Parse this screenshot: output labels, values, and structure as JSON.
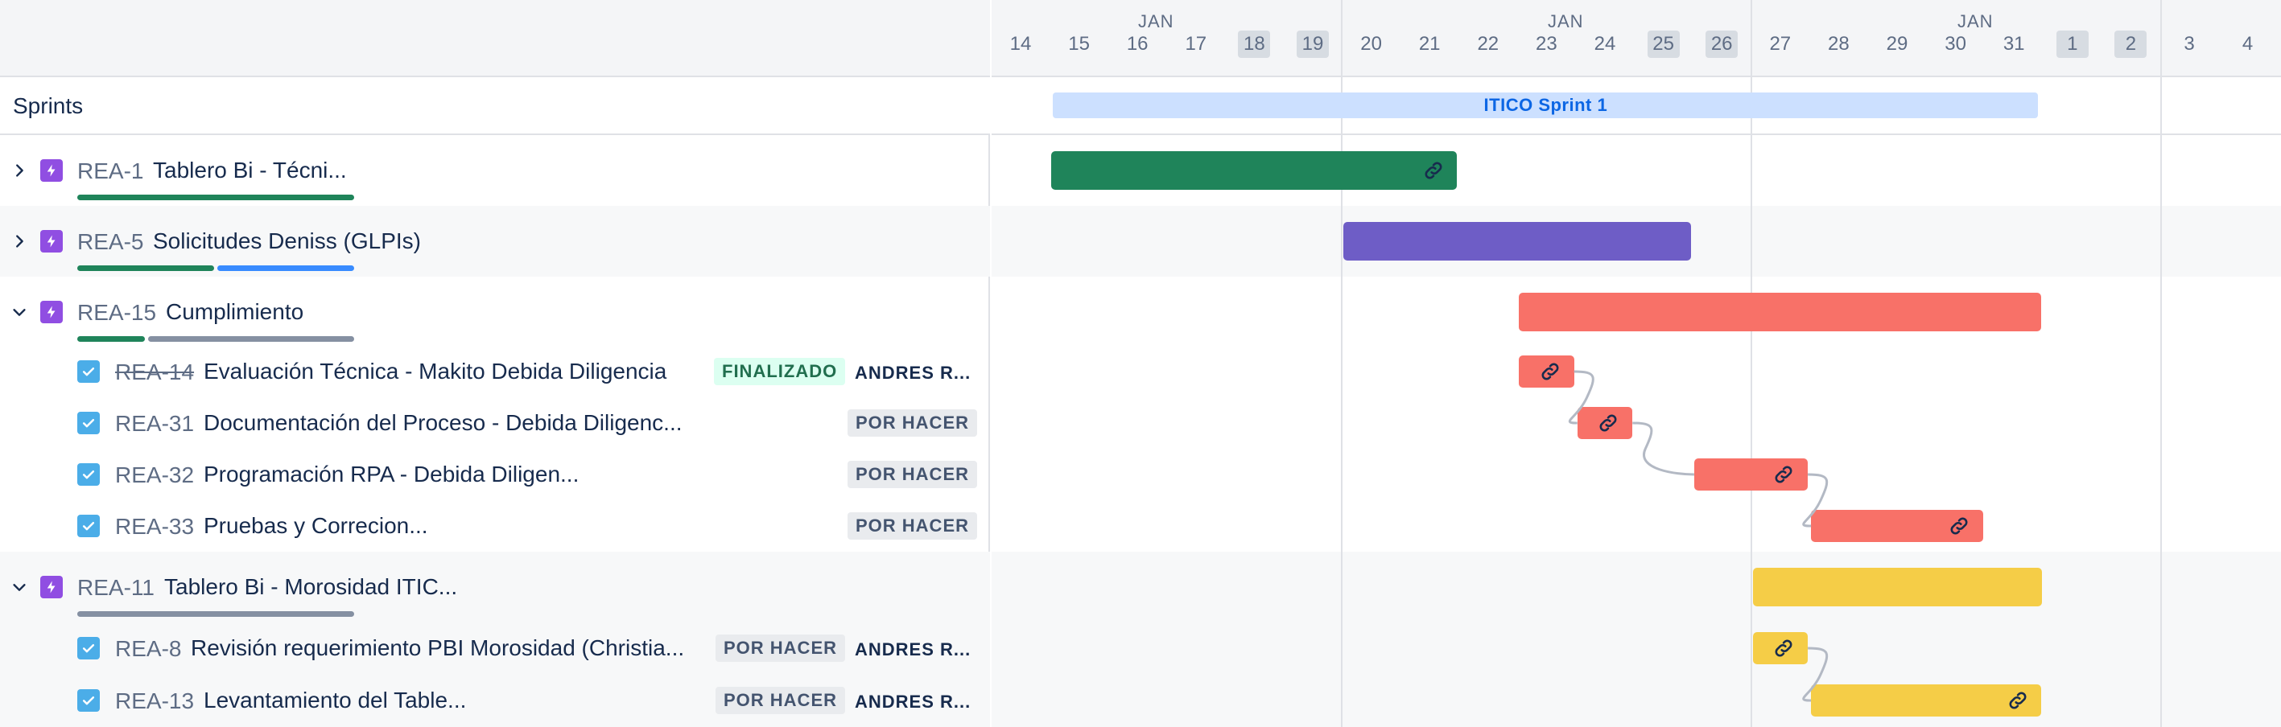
{
  "colors": {
    "green": "#1f845a",
    "purple": "#6e5dc6",
    "red": "#f87168",
    "yellow": "#f5cd47",
    "blue_progress": "#388bff",
    "grey_progress": "#8590a2",
    "sprint_bg": "#cce0ff",
    "sprint_text": "#0c66e4"
  },
  "left": {
    "sprints_label": "Sprints"
  },
  "timeline": {
    "month_labels": [
      "JAN",
      "JAN",
      "JAN"
    ],
    "days": [
      {
        "label": "14",
        "weekend": false
      },
      {
        "label": "15",
        "weekend": false
      },
      {
        "label": "16",
        "weekend": false
      },
      {
        "label": "17",
        "weekend": false
      },
      {
        "label": "18",
        "weekend": true
      },
      {
        "label": "19",
        "weekend": true
      },
      {
        "label": "20",
        "weekend": false
      },
      {
        "label": "21",
        "weekend": false
      },
      {
        "label": "22",
        "weekend": false
      },
      {
        "label": "23",
        "weekend": false
      },
      {
        "label": "24",
        "weekend": false
      },
      {
        "label": "25",
        "weekend": true
      },
      {
        "label": "26",
        "weekend": true
      },
      {
        "label": "27",
        "weekend": false
      },
      {
        "label": "28",
        "weekend": false
      },
      {
        "label": "29",
        "weekend": false
      },
      {
        "label": "30",
        "weekend": false
      },
      {
        "label": "31",
        "weekend": false
      },
      {
        "label": "1",
        "weekend": true
      },
      {
        "label": "2",
        "weekend": true
      },
      {
        "label": "3",
        "weekend": false
      },
      {
        "label": "4",
        "weekend": false
      }
    ],
    "sprint": {
      "name": "ITICO Sprint 1",
      "start": "15",
      "end": "31"
    }
  },
  "issues": [
    {
      "key": "REA-1",
      "title": "Tablero Bi - Técni...",
      "type": "epic",
      "expanded": false,
      "progress": [
        {
          "color": "green",
          "fraction": 1.0
        }
      ],
      "bar": {
        "color": "green",
        "start": "15",
        "end": "21",
        "linked": true
      }
    },
    {
      "key": "REA-5",
      "title": "Solicitudes Deniss (GLPIs)",
      "type": "epic",
      "expanded": false,
      "progress": [
        {
          "color": "green",
          "fraction": 0.5
        },
        {
          "color": "blue_progress",
          "fraction": 0.5
        }
      ],
      "bar": {
        "color": "purple",
        "start": "20",
        "end": "25",
        "linked": false
      }
    },
    {
      "key": "REA-15",
      "title": "Cumplimiento",
      "type": "epic",
      "expanded": true,
      "progress": [
        {
          "color": "green",
          "fraction": 0.25
        },
        {
          "color": "grey_progress",
          "fraction": 0.75
        }
      ],
      "bar": {
        "color": "red",
        "start": "23",
        "end": "31",
        "linked": false
      }
    },
    {
      "key": "REA-14",
      "title": "Evaluación Técnica - Makito Debida Diligencia",
      "type": "task",
      "done": true,
      "status": "FINALIZADO",
      "assignee": "ANDRES R...",
      "bar": {
        "color": "red",
        "start": "23",
        "end": "23",
        "linked": true
      }
    },
    {
      "key": "REA-31",
      "title": "Documentación del Proceso - Debida Diligenc...",
      "type": "task",
      "done": false,
      "status": "POR HACER",
      "assignee": "",
      "bar": {
        "color": "red",
        "start": "24",
        "end": "24",
        "linked": true
      }
    },
    {
      "key": "REA-32",
      "title": "Programación RPA - Debida Diligen...",
      "type": "task",
      "done": false,
      "status": "POR HACER",
      "assignee": "",
      "bar": {
        "color": "red",
        "start": "26",
        "end": "27",
        "linked": true
      }
    },
    {
      "key": "REA-33",
      "title": "Pruebas y Correcion...",
      "type": "task",
      "done": false,
      "status": "POR HACER",
      "assignee": "",
      "bar": {
        "color": "red",
        "start": "28",
        "end": "30",
        "linked": true
      }
    },
    {
      "key": "REA-11",
      "title": "Tablero Bi - Morosidad ITIC...",
      "type": "epic",
      "expanded": true,
      "progress": [
        {
          "color": "grey_progress",
          "fraction": 1.0
        }
      ],
      "bar": {
        "color": "yellow",
        "start": "27",
        "end": "31",
        "linked": false
      }
    },
    {
      "key": "REA-8",
      "title": "Revisión requerimiento PBI Morosidad (Christia...",
      "type": "task",
      "done": false,
      "status": "POR HACER",
      "assignee": "ANDRES R...",
      "bar": {
        "color": "yellow",
        "start": "27",
        "end": "27",
        "linked": true
      }
    },
    {
      "key": "REA-13",
      "title": "Levantamiento del Table...",
      "type": "task",
      "done": false,
      "status": "POR HACER",
      "assignee": "ANDRES R...",
      "bar": {
        "color": "yellow",
        "start": "28",
        "end": "31",
        "linked": true
      }
    }
  ]
}
